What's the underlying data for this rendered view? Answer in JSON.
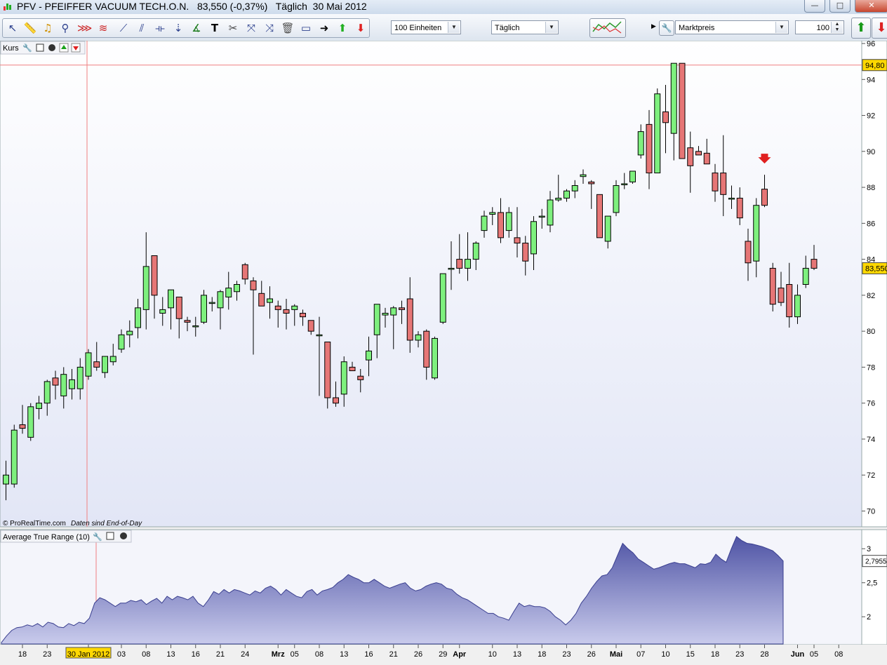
{
  "window": {
    "title": "PFV - PFEIFFER VACUUM TECH.O.N.   83,550 (-0,37%)   Täglich  30 Mai 2012",
    "min_glyph": "—",
    "max_glyph": "□",
    "close_glyph": "✕"
  },
  "toolbar": {
    "units_select": "100 Einheiten",
    "period_select": "Täglich",
    "price_type_select": "Marktpreis",
    "bars_value": "100",
    "buttons": [
      "pointer-icon",
      "ruler-icon",
      "alarm-bell-icon",
      "zoom-icon",
      "fibonacci-icon",
      "pattern-icon",
      "trendline-icon",
      "channel-icon",
      "horizontal-line-icon",
      "vertical-line-icon",
      "indicator-icon",
      "text-icon",
      "tools-icon",
      "draw-icon",
      "trash-icon",
      "rectangle-icon",
      "arrow-right-icon",
      "buy-arrow-icon",
      "sell-arrow-icon"
    ]
  },
  "colors": {
    "up": "#7ef07e",
    "down": "#e67676",
    "atr_fill_top": "#4f54a5",
    "atr_fill_bottom": "#c9cbec",
    "crosshair": "#f08080",
    "last_price_bg": "#ffd800"
  },
  "chart_data": [
    {
      "type": "candlestick",
      "panel_title": "Kurs",
      "copyright": "© ProRealTime.com",
      "note": "Daten sind End-of-Day",
      "ylim": [
        69.2,
        96
      ],
      "y_ticks": [
        70,
        72,
        74,
        76,
        78,
        80,
        82,
        84,
        86,
        88,
        90,
        92,
        94,
        96
      ],
      "y_tick_labels": [
        "70",
        "72",
        "74",
        "76",
        "78",
        "80",
        "82",
        "84",
        "86",
        "88",
        "90",
        "92",
        "94",
        "96"
      ],
      "last_price_label": "83,550",
      "crosshair_label": "94,80",
      "crosshair_value": 94.8,
      "sell_signal_index": 92,
      "candles": [
        [
          71.5,
          72.8,
          70.6,
          72.0
        ],
        [
          71.5,
          74.8,
          71.3,
          74.5
        ],
        [
          74.8,
          75.9,
          74.3,
          74.6
        ],
        [
          74.1,
          76.0,
          73.9,
          75.8
        ],
        [
          75.7,
          76.4,
          75.1,
          76.0
        ],
        [
          76.0,
          77.3,
          75.3,
          77.2
        ],
        [
          77.4,
          77.8,
          76.2,
          77.0
        ],
        [
          76.4,
          78.0,
          75.7,
          77.6
        ],
        [
          76.8,
          77.9,
          76.2,
          77.3
        ],
        [
          76.8,
          78.5,
          76.2,
          78.0
        ],
        [
          77.5,
          79.0,
          77.3,
          78.8
        ],
        [
          78.3,
          79.4,
          77.8,
          78.0
        ],
        [
          77.7,
          78.6,
          77.4,
          78.6
        ],
        [
          78.3,
          79.3,
          78.1,
          78.6
        ],
        [
          79.0,
          80.1,
          78.8,
          79.8
        ],
        [
          79.8,
          80.6,
          79.1,
          80.0
        ],
        [
          80.2,
          81.8,
          79.6,
          81.3
        ],
        [
          81.2,
          85.5,
          80.1,
          83.6
        ],
        [
          84.2,
          84.2,
          80.7,
          82.0
        ],
        [
          81.0,
          81.9,
          80.3,
          81.2
        ],
        [
          81.3,
          82.3,
          80.1,
          82.3
        ],
        [
          81.9,
          81.9,
          79.6,
          80.7
        ],
        [
          80.6,
          80.8,
          80.0,
          80.5
        ],
        [
          80.3,
          80.8,
          79.7,
          80.3
        ],
        [
          80.5,
          82.3,
          80.4,
          82.0
        ],
        [
          81.6,
          81.9,
          81.1,
          81.6
        ],
        [
          81.3,
          82.3,
          80.1,
          82.2
        ],
        [
          81.9,
          83.3,
          81.2,
          82.4
        ],
        [
          82.2,
          82.8,
          81.7,
          82.6
        ],
        [
          83.7,
          83.8,
          82.6,
          82.9
        ],
        [
          82.8,
          83.0,
          78.7,
          82.3
        ],
        [
          82.1,
          82.8,
          81.5,
          81.4
        ],
        [
          81.6,
          82.5,
          80.7,
          81.8
        ],
        [
          81.4,
          81.7,
          80.2,
          81.2
        ],
        [
          81.2,
          81.8,
          80.1,
          81.0
        ],
        [
          81.2,
          81.5,
          80.3,
          81.4
        ],
        [
          81.0,
          81.2,
          80.3,
          80.8
        ],
        [
          80.6,
          80.6,
          79.8,
          80.0
        ],
        [
          79.8,
          80.8,
          76.4,
          79.8
        ],
        [
          79.4,
          79.4,
          75.7,
          76.3
        ],
        [
          76.3,
          77.2,
          75.8,
          76.0
        ],
        [
          76.5,
          78.6,
          75.8,
          78.3
        ],
        [
          78.0,
          78.3,
          77.8,
          77.8
        ],
        [
          77.5,
          77.9,
          76.6,
          77.3
        ],
        [
          78.4,
          79.7,
          77.5,
          78.9
        ],
        [
          79.8,
          81.3,
          78.5,
          81.5
        ],
        [
          80.9,
          81.3,
          80.2,
          81.0
        ],
        [
          80.9,
          81.4,
          79.0,
          81.3
        ],
        [
          81.3,
          81.7,
          80.4,
          81.2
        ],
        [
          81.8,
          83.0,
          78.8,
          79.5
        ],
        [
          79.5,
          80.0,
          79.1,
          79.8
        ],
        [
          80.0,
          80.1,
          77.3,
          78.0
        ],
        [
          77.4,
          79.7,
          77.3,
          79.6
        ],
        [
          80.5,
          83.1,
          80.4,
          83.2
        ],
        [
          83.5,
          85.0,
          82.3,
          83.5
        ],
        [
          84.0,
          85.4,
          83.2,
          83.5
        ],
        [
          83.5,
          85.5,
          82.8,
          84.0
        ],
        [
          84.0,
          85.0,
          83.4,
          84.9
        ],
        [
          85.6,
          86.7,
          85.2,
          86.4
        ],
        [
          86.5,
          86.9,
          85.9,
          86.6
        ],
        [
          86.6,
          87.4,
          84.9,
          85.2
        ],
        [
          85.6,
          86.9,
          85.2,
          86.6
        ],
        [
          85.2,
          86.9,
          84.1,
          84.9
        ],
        [
          84.9,
          85.3,
          83.1,
          83.9
        ],
        [
          84.3,
          86.4,
          83.4,
          86.1
        ],
        [
          86.4,
          86.8,
          85.7,
          86.4
        ],
        [
          85.9,
          87.8,
          85.5,
          87.3
        ],
        [
          87.3,
          88.7,
          87.2,
          87.4
        ],
        [
          87.4,
          87.9,
          87.2,
          87.8
        ],
        [
          87.8,
          88.4,
          87.4,
          88.1
        ],
        [
          88.6,
          89.0,
          88.2,
          88.7
        ],
        [
          88.3,
          88.4,
          86.8,
          88.2
        ],
        [
          87.6,
          87.6,
          85.7,
          85.2
        ],
        [
          85.0,
          86.4,
          84.6,
          86.4
        ],
        [
          86.6,
          88.4,
          86.4,
          88.1
        ],
        [
          88.2,
          88.8,
          87.9,
          88.2
        ],
        [
          88.3,
          88.9,
          88.2,
          88.9
        ],
        [
          89.8,
          91.5,
          89.6,
          91.1
        ],
        [
          91.5,
          92.3,
          87.9,
          88.8
        ],
        [
          88.8,
          93.5,
          89.5,
          93.2
        ],
        [
          92.2,
          93.7,
          89.9,
          91.6
        ],
        [
          91.0,
          94.8,
          89.5,
          94.9
        ],
        [
          94.9,
          94.9,
          89.6,
          89.6
        ],
        [
          90.2,
          91.1,
          87.7,
          89.2
        ],
        [
          90.0,
          90.3,
          89.8,
          89.8
        ],
        [
          89.9,
          90.7,
          89.4,
          89.3
        ],
        [
          88.8,
          89.3,
          87.2,
          87.8
        ],
        [
          88.8,
          90.9,
          86.4,
          87.6
        ],
        [
          87.4,
          88.1,
          86.8,
          87.4
        ],
        [
          87.4,
          88.0,
          85.9,
          86.3
        ],
        [
          85.0,
          85.7,
          82.8,
          83.8
        ],
        [
          83.9,
          87.4,
          83.0,
          87.0
        ],
        [
          87.9,
          88.7,
          86.9,
          87.0
        ]
      ],
      "tail_candles": [
        [
          83.5,
          83.8,
          81.1,
          81.5
        ],
        [
          82.4,
          83.3,
          81.4,
          81.6
        ],
        [
          82.6,
          83.8,
          80.2,
          80.8
        ],
        [
          80.8,
          82.6,
          80.4,
          82.0
        ],
        [
          82.6,
          84.2,
          82.4,
          83.5
        ],
        [
          84.0,
          84.8,
          83.4,
          83.5
        ]
      ]
    },
    {
      "type": "area",
      "panel_title": "Average True Range (10)",
      "ylim": [
        1.6,
        3.25
      ],
      "y_ticks": [
        2,
        2.5,
        3
      ],
      "y_tick_labels": [
        "2",
        "2,5",
        "3"
      ],
      "last_value_label": "2,7955",
      "values": [
        1.62,
        1.72,
        1.8,
        1.84,
        1.85,
        1.88,
        1.86,
        1.9,
        1.85,
        1.92,
        1.9,
        1.85,
        1.84,
        1.9,
        1.87,
        1.92,
        1.9,
        1.98,
        2.2,
        2.28,
        2.25,
        2.2,
        2.15,
        2.2,
        2.2,
        2.24,
        2.22,
        2.25,
        2.18,
        2.23,
        2.27,
        2.2,
        2.3,
        2.25,
        2.3,
        2.28,
        2.25,
        2.3,
        2.2,
        2.15,
        2.25,
        2.37,
        2.33,
        2.4,
        2.35,
        2.4,
        2.38,
        2.35,
        2.32,
        2.38,
        2.35,
        2.42,
        2.45,
        2.4,
        2.32,
        2.4,
        2.35,
        2.3,
        2.28,
        2.37,
        2.4,
        2.32,
        2.38,
        2.4,
        2.43,
        2.5,
        2.55,
        2.62,
        2.58,
        2.55,
        2.5,
        2.5,
        2.55,
        2.5,
        2.45,
        2.42,
        2.45,
        2.48,
        2.5,
        2.42,
        2.38,
        2.4,
        2.45,
        2.48,
        2.5,
        2.48,
        2.42,
        2.4,
        2.33,
        2.28,
        2.25,
        2.2,
        2.15,
        2.1,
        2.05,
        2.05,
        2.0,
        1.98,
        1.95,
        2.08,
        2.2,
        2.15,
        2.17,
        2.15,
        2.15,
        2.13,
        2.08,
        2.0,
        1.95,
        1.88,
        1.95,
        2.05,
        2.2,
        2.3,
        2.42,
        2.52,
        2.6,
        2.62,
        2.72,
        2.9,
        3.08,
        3.0,
        2.94,
        2.85,
        2.8,
        2.75,
        2.7,
        2.72,
        2.75,
        2.78,
        2.8,
        2.78,
        2.78,
        2.75,
        2.72,
        2.78,
        2.77,
        2.8,
        2.92,
        2.85,
        2.8,
        3.0,
        3.18,
        3.12,
        3.08,
        3.07,
        3.05,
        3.03,
        3.0,
        2.97,
        2.9,
        2.82
      ]
    }
  ],
  "xaxis": {
    "labels": [
      {
        "t": "18",
        "i": 2
      },
      {
        "t": "23",
        "i": 5
      },
      {
        "t": "30 Jan 2012",
        "i": 10,
        "hl": true
      },
      {
        "t": "03",
        "i": 14
      },
      {
        "t": "08",
        "i": 17
      },
      {
        "t": "13",
        "i": 20
      },
      {
        "t": "16",
        "i": 23
      },
      {
        "t": "21",
        "i": 26
      },
      {
        "t": "24",
        "i": 29
      },
      {
        "t": "Mrz",
        "i": 33,
        "bold": true
      },
      {
        "t": "05",
        "i": 35
      },
      {
        "t": "08",
        "i": 38
      },
      {
        "t": "13",
        "i": 41
      },
      {
        "t": "16",
        "i": 44
      },
      {
        "t": "21",
        "i": 47
      },
      {
        "t": "26",
        "i": 50
      },
      {
        "t": "29",
        "i": 53
      },
      {
        "t": "Apr",
        "i": 55,
        "bold": true
      },
      {
        "t": "10",
        "i": 59
      },
      {
        "t": "13",
        "i": 62
      },
      {
        "t": "18",
        "i": 65
      },
      {
        "t": "23",
        "i": 68
      },
      {
        "t": "26",
        "i": 71
      },
      {
        "t": "Mai",
        "i": 74,
        "bold": true
      },
      {
        "t": "07",
        "i": 77
      },
      {
        "t": "10",
        "i": 80
      },
      {
        "t": "15",
        "i": 83
      },
      {
        "t": "18",
        "i": 86
      },
      {
        "t": "23",
        "i": 89
      },
      {
        "t": "28",
        "i": 92
      },
      {
        "t": "Jun",
        "i": 96,
        "bold": true
      },
      {
        "t": "05",
        "i": 98
      },
      {
        "t": "08",
        "i": 101
      }
    ]
  }
}
